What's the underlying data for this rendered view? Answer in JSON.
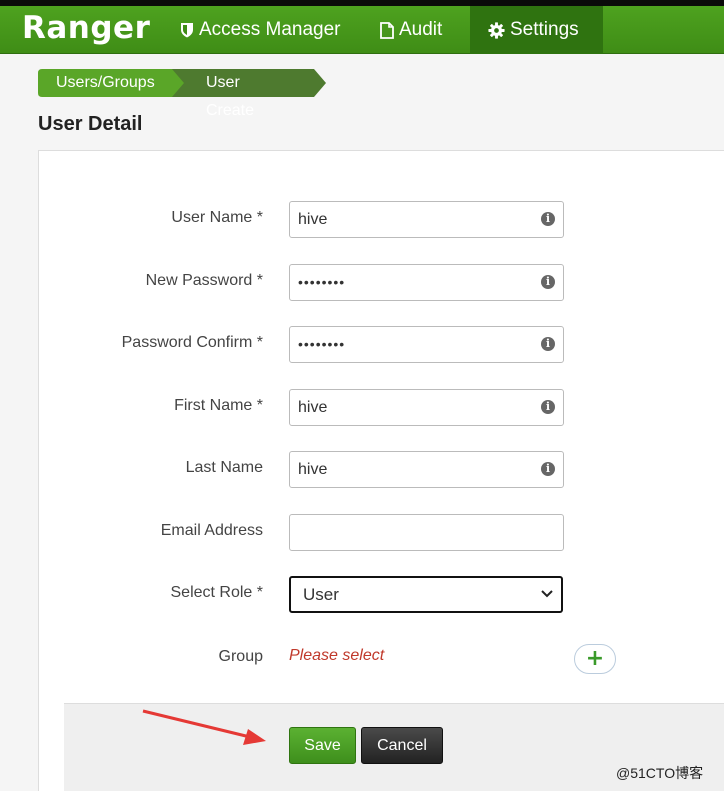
{
  "navbar": {
    "brand": "Ranger",
    "items": [
      {
        "label": "Access Manager",
        "icon": "shield-icon"
      },
      {
        "label": "Audit",
        "icon": "file-icon"
      },
      {
        "label": "Settings",
        "icon": "gear-icon",
        "active": true
      }
    ]
  },
  "breadcrumb": [
    "Users/Groups",
    "User Create"
  ],
  "page_title": "User Detail",
  "form": {
    "user_name": {
      "label": "User Name *",
      "value": "hive"
    },
    "new_password": {
      "label": "New Password *",
      "value": "••••••••"
    },
    "password_confirm": {
      "label": "Password Confirm *",
      "value": "••••••••"
    },
    "first_name": {
      "label": "First Name *",
      "value": "hive"
    },
    "last_name": {
      "label": "Last Name",
      "value": "hive"
    },
    "email": {
      "label": "Email Address",
      "value": ""
    },
    "role": {
      "label": "Select Role *",
      "value": "User"
    },
    "group": {
      "label": "Group",
      "placeholder": "Please select"
    }
  },
  "buttons": {
    "save": "Save",
    "cancel": "Cancel"
  },
  "watermark": "@51CTO博客",
  "colors": {
    "brand_green": "#46991a",
    "annotation_arrow": "#e53935"
  }
}
